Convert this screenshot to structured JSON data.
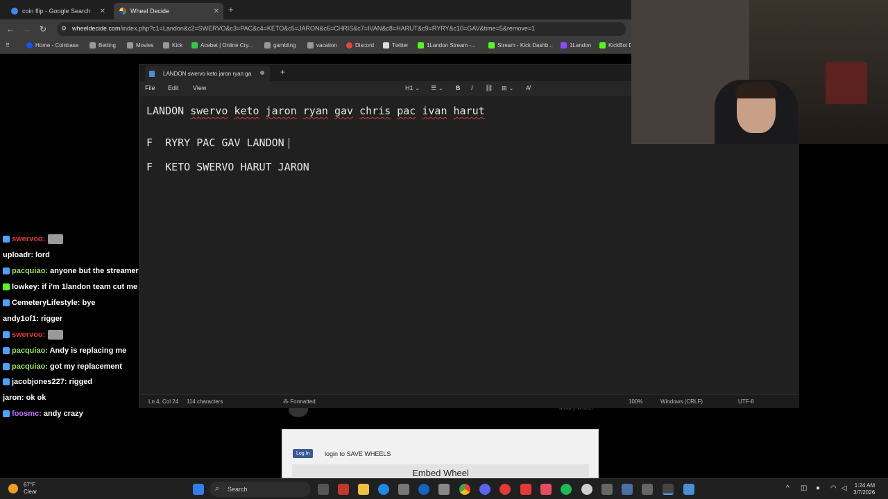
{
  "browser": {
    "tabs": [
      {
        "title": "coin flip - Google Search",
        "active": false
      },
      {
        "title": "Wheel Decide",
        "active": true
      }
    ],
    "url_host": "wheeldecide.com",
    "url_path": "/index.php?c1=Landon&c2=SWERVO&c3=PAC&c4=KETO&c5=JARON&c6=CHRIS&c7=IVAN&c8=HARUT&c9=RYRY&c10=GAV&time=5&remove=1",
    "bookmarks": [
      {
        "label": "Home - Coinbase",
        "color": "#1652f0"
      },
      {
        "label": "Betting",
        "color": "#888888"
      },
      {
        "label": "Movies",
        "color": "#888888"
      },
      {
        "label": "Kick",
        "color": "#888888"
      },
      {
        "label": "Acebet | Online Cry...",
        "color": "#2ecc40"
      },
      {
        "label": "gambling",
        "color": "#888888"
      },
      {
        "label": "vacation",
        "color": "#888888"
      },
      {
        "label": "Discord",
        "color": "#e8453c"
      },
      {
        "label": "Twitter",
        "color": "#dddddd"
      },
      {
        "label": "1Landon Stream -...",
        "color": "#53fc18"
      },
      {
        "label": "Stream - Kick Dashb...",
        "color": "#53fc18"
      },
      {
        "label": "1Landon",
        "color": "#9146ff"
      },
      {
        "label": "KickBot D",
        "color": "#53fc18"
      }
    ]
  },
  "notepad": {
    "tab_title": "LANDON swervo keto jaron ryan ga",
    "menu": {
      "file": "File",
      "edit": "Edit",
      "view": "View"
    },
    "toolbar": {
      "heading": "H1"
    },
    "lines": {
      "line1_parts": [
        {
          "text": "LANDON",
          "spell": false
        },
        {
          "text": "swervo",
          "spell": true
        },
        {
          "text": "keto",
          "spell": true
        },
        {
          "text": "jaron",
          "spell": true
        },
        {
          "text": "ryan",
          "spell": true
        },
        {
          "text": "gav",
          "spell": true
        },
        {
          "text": "chris",
          "spell": true
        },
        {
          "text": "pac",
          "spell": true
        },
        {
          "text": "ivan",
          "spell": true
        },
        {
          "text": "harut",
          "spell": true
        }
      ],
      "line3": "F  RYRY PAC GAV LANDON",
      "line4": "F  KETO SWERVO HARUT JARON"
    },
    "status": {
      "position": "Ln 4, Col 24",
      "characters": "114 characters",
      "format": "Formatted",
      "zoom": "100%",
      "line_ending": "Windows (CRLF)",
      "encoding": "UTF-8"
    }
  },
  "chat": [
    {
      "user": "swervoo:",
      "user_color": "#e03a3a",
      "text": "",
      "emote": true,
      "badge": "#4aa3ff"
    },
    {
      "user": "uploadr:",
      "user_color": "#ffffff",
      "text": " lord",
      "emote": false,
      "badge": ""
    },
    {
      "user": "pacquiao:",
      "user_color": "#9be34a",
      "text": " anyone but the streamer",
      "emote": false,
      "badge": "#4aa3ff"
    },
    {
      "user": "lowkey:",
      "user_color": "#ffffff",
      "text": " if i'm 1landon team cut me",
      "emote": false,
      "badge": "#53fc18"
    },
    {
      "user": "CemeteryLifestyle:",
      "user_color": "#ffffff",
      "text": " bye",
      "emote": false,
      "badge": "#4aa3ff"
    },
    {
      "user": "andy1of1:",
      "user_color": "#ffffff",
      "text": " rigger",
      "emote": false,
      "badge": ""
    },
    {
      "user": "swervoo:",
      "user_color": "#e03a3a",
      "text": "",
      "emote": true,
      "badge": "#4aa3ff"
    },
    {
      "user": "pacquiao:",
      "user_color": "#9be34a",
      "text": " Andy is replacing me",
      "emote": false,
      "badge": "#4aa3ff"
    },
    {
      "user": "pacquiao:",
      "user_color": "#9be34a",
      "text": " got my replacement",
      "emote": false,
      "badge": "#4aa3ff"
    },
    {
      "user": "jacobjones227:",
      "user_color": "#ffffff",
      "text": " rigged",
      "emote": false,
      "badge": "#4aa3ff"
    },
    {
      "user": "jaron:",
      "user_color": "#ffffff",
      "text": " ok ok",
      "emote": false,
      "badge": ""
    },
    {
      "user": "foosmc:",
      "user_color": "#c070ff",
      "text": " andy crazy",
      "emote": false,
      "badge": "#4aa3ff"
    }
  ],
  "wheel_page": {
    "modify": "Modify Wheel",
    "fb_login": "Log In",
    "save_text": "login to SAVE WHEELS",
    "embed": "Embed Wheel"
  },
  "taskbar": {
    "temp": "67°F",
    "condition": "Clear",
    "search": "Search",
    "time": "1:24 AM",
    "date": "3/7/2026"
  }
}
